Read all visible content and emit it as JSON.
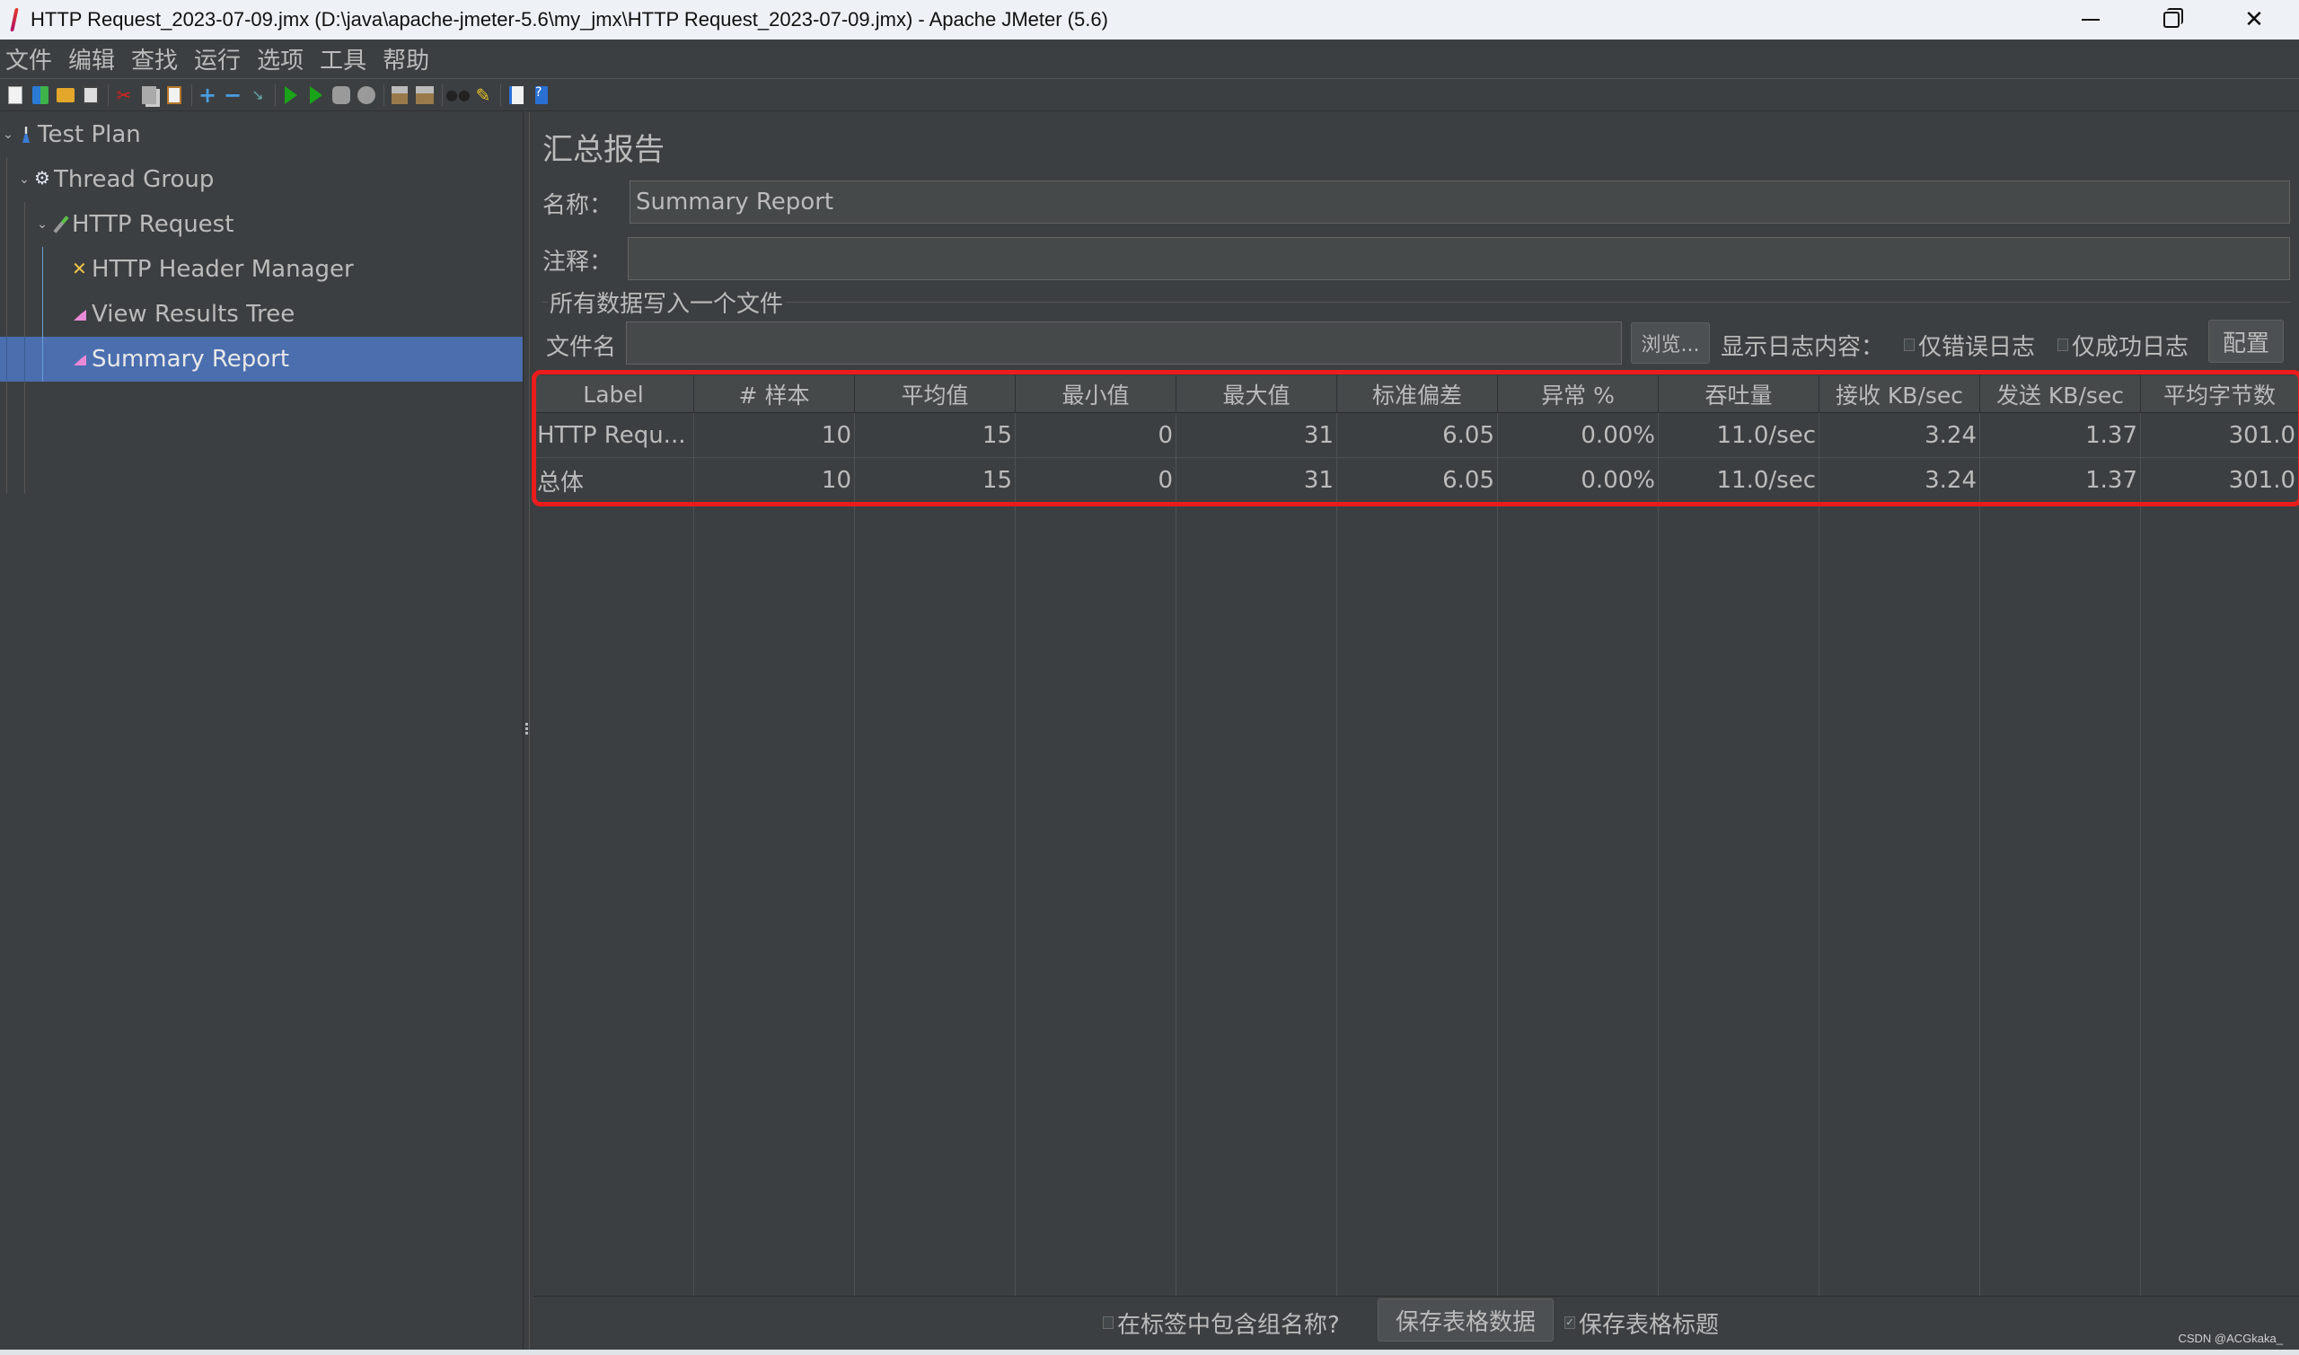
{
  "window": {
    "title": "HTTP Request_2023-07-09.jmx (D:\\java\\apache-jmeter-5.6\\my_jmx\\HTTP Request_2023-07-09.jmx) - Apache JMeter (5.6)",
    "minimize": "minimize",
    "maximize": "restore",
    "close": "close"
  },
  "menu": [
    "文件",
    "编辑",
    "查找",
    "运行",
    "选项",
    "工具",
    "帮助"
  ],
  "toolbar": [
    "new-icon",
    "templates-icon",
    "open-icon",
    "save-icon",
    "cut-icon",
    "copy-icon",
    "paste-icon",
    "expand-icon",
    "collapse-icon",
    "toggle-icon",
    "start-icon",
    "start-no-pauses-icon",
    "stop-icon",
    "shutdown-icon",
    "clear-icon",
    "clear-all-icon",
    "search-icon",
    "reset-search-icon",
    "function-helper-icon",
    "help-icon"
  ],
  "tree": {
    "items": [
      {
        "label": "Test Plan",
        "icon": "flask-icon",
        "level": 0,
        "expanded": true
      },
      {
        "label": "Thread Group",
        "icon": "gear-icon",
        "level": 1,
        "expanded": true
      },
      {
        "label": "HTTP Request",
        "icon": "pipette-icon",
        "level": 2,
        "expanded": true
      },
      {
        "label": "HTTP Header Manager",
        "icon": "tools-icon",
        "level": 3
      },
      {
        "label": "View Results Tree",
        "icon": "listener-icon",
        "level": 3
      },
      {
        "label": "Summary Report",
        "icon": "listener-icon",
        "level": 3,
        "selected": true
      }
    ]
  },
  "panel": {
    "title": "汇总报告",
    "name_label": "名称：",
    "name_value": "Summary Report",
    "comment_label": "注释：",
    "comment_value": "",
    "file_group_title": "所有数据写入一个文件",
    "filename_label": "文件名",
    "filename_value": "",
    "browse_button": "浏览...",
    "log_label": "显示日志内容：",
    "errors_only": {
      "label": "仅错误日志",
      "checked": false
    },
    "success_only": {
      "label": "仅成功日志",
      "checked": false
    },
    "configure_button": "配置"
  },
  "table": {
    "columns": [
      "Label",
      "# 样本",
      "平均值",
      "最小值",
      "最大值",
      "标准偏差",
      "异常 %",
      "吞吐量",
      "接收 KB/sec",
      "发送 KB/sec",
      "平均字节数"
    ],
    "rows": [
      [
        "HTTP Requ...",
        "10",
        "15",
        "0",
        "31",
        "6.05",
        "0.00%",
        "11.0/sec",
        "3.24",
        "1.37",
        "301.0"
      ],
      [
        "总体",
        "10",
        "15",
        "0",
        "31",
        "6.05",
        "0.00%",
        "11.0/sec",
        "3.24",
        "1.37",
        "301.0"
      ]
    ]
  },
  "bottom": {
    "include_group_name": {
      "label": "在标签中包含组名称?",
      "checked": false
    },
    "save_table_button": "保存表格数据",
    "save_header": {
      "label": "保存表格标题",
      "checked": true
    }
  },
  "watermark": "CSDN @ACGkaka_",
  "colors": {
    "background": "#3c3f41",
    "selection": "#4b6eaf",
    "highlight_box": "#ec1c1c"
  }
}
